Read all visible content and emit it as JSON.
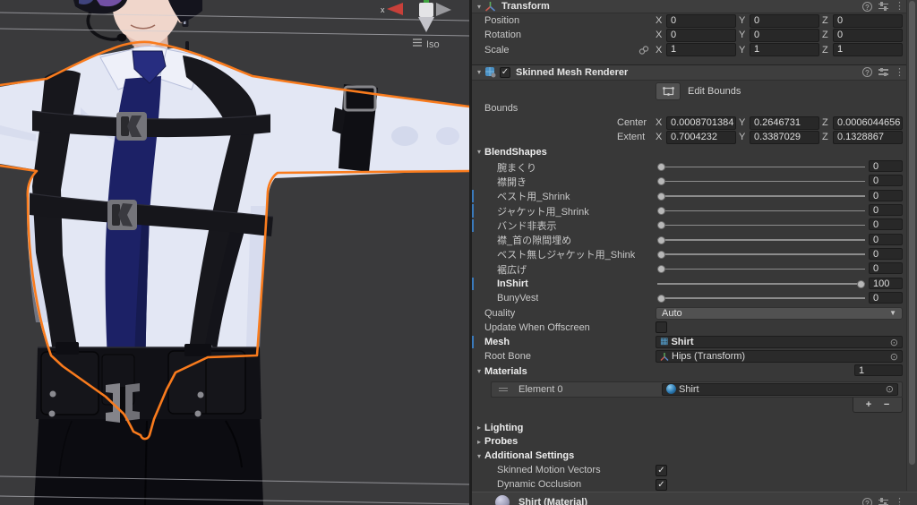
{
  "scene": {
    "view_mode_label": "Iso",
    "gizmo_axis_label": "x",
    "selection_outline_color": "#f97b1d",
    "background_color": "#3a3a3c"
  },
  "inspector": {
    "axes": [
      "X",
      "Y",
      "Z"
    ],
    "transform": {
      "title": "Transform",
      "rows": [
        {
          "label": "Position",
          "x": "0",
          "y": "0",
          "z": "0"
        },
        {
          "label": "Rotation",
          "x": "0",
          "y": "0",
          "z": "0"
        },
        {
          "label": "Scale",
          "x": "1",
          "y": "1",
          "z": "1"
        }
      ]
    },
    "smr": {
      "title": "Skinned Mesh Renderer",
      "enabled": true,
      "edit_bounds_label": "Edit Bounds",
      "bounds_label": "Bounds",
      "center": {
        "label": "Center",
        "x": "0.0008701384",
        "y": "0.2646731",
        "z": "0.0006044656"
      },
      "extent": {
        "label": "Extent",
        "x": "0.7004232",
        "y": "0.3387029",
        "z": "0.1328867"
      },
      "blendshapes_label": "BlendShapes",
      "blendshapes": [
        {
          "label": "腕まくり",
          "value": 0,
          "override": false,
          "bold": false
        },
        {
          "label": "襟開き",
          "value": 0,
          "override": false,
          "bold": false
        },
        {
          "label": "ベスト用_Shrink",
          "value": 0,
          "override": true,
          "bold": false
        },
        {
          "label": "ジャケット用_Shrink",
          "value": 0,
          "override": true,
          "bold": false
        },
        {
          "label": "バンド非表示",
          "value": 0,
          "override": true,
          "bold": false
        },
        {
          "label": "襟_首の隙間埋め",
          "value": 0,
          "override": false,
          "bold": false
        },
        {
          "label": "ベスト無しジャケット用_Shink",
          "value": 0,
          "override": false,
          "bold": false
        },
        {
          "label": "裾広げ",
          "value": 0,
          "override": false,
          "bold": false
        },
        {
          "label": "InShirt",
          "value": 100,
          "override": true,
          "bold": true
        },
        {
          "label": "BunyVest",
          "value": 0,
          "override": false,
          "bold": false
        }
      ],
      "quality": {
        "label": "Quality",
        "value": "Auto"
      },
      "update_when_offscreen": {
        "label": "Update When Offscreen",
        "checked": false
      },
      "mesh": {
        "label": "Mesh",
        "value": "Shirt",
        "override": true
      },
      "root_bone": {
        "label": "Root Bone",
        "value": "Hips (Transform)"
      },
      "materials": {
        "label": "Materials",
        "count": "1",
        "elements": [
          {
            "label": "Element 0",
            "value": "Shirt"
          }
        ],
        "add_label": "+",
        "remove_label": "−"
      },
      "lighting_label": "Lighting",
      "probes_label": "Probes",
      "additional_settings": {
        "label": "Additional Settings",
        "skinned_motion_vectors": {
          "label": "Skinned Motion Vectors",
          "checked": true
        },
        "dynamic_occlusion": {
          "label": "Dynamic Occlusion",
          "checked": true
        }
      }
    },
    "material_bar": {
      "title": "Shirt (Material)"
    },
    "override_bar_color": "#3a79bb"
  }
}
